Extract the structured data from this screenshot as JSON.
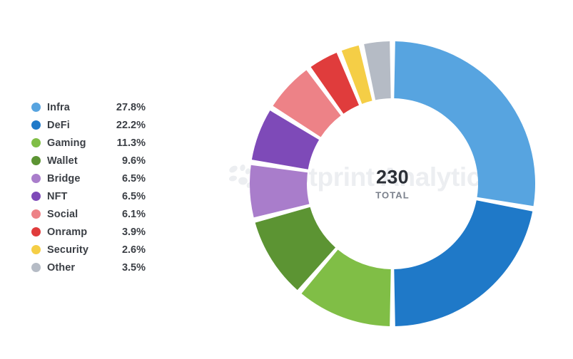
{
  "chart_data": {
    "type": "pie",
    "title": "",
    "subtitle": "",
    "variant": "donut",
    "categories": [
      "Infra",
      "DeFi",
      "Gaming",
      "Wallet",
      "Bridge",
      "NFT",
      "Social",
      "Onramp",
      "Security",
      "Other"
    ],
    "values": [
      27.8,
      22.2,
      11.3,
      9.6,
      6.5,
      6.5,
      6.1,
      3.9,
      2.6,
      3.5
    ],
    "value_labels": [
      "27.8%",
      "22.2%",
      "11.3%",
      "9.6%",
      "6.5%",
      "6.5%",
      "6.1%",
      "3.9%",
      "2.6%",
      "3.5%"
    ],
    "unit": "%",
    "colors": [
      "#57A4E0",
      "#1F79C8",
      "#80BE46",
      "#5C9433",
      "#A97DCB",
      "#7E4AB8",
      "#ED8287",
      "#E03C3C",
      "#F5CE46",
      "#B5BBC5"
    ],
    "total": 230,
    "total_label": "TOTAL",
    "start_angle_deg": 0,
    "direction": "clockwise",
    "inner_radius_ratio": 0.6,
    "legend_position": "left",
    "grid": false
  },
  "legend": {
    "items": [
      {
        "label": "Infra",
        "value": "27.8%",
        "color": "#57A4E0"
      },
      {
        "label": "DeFi",
        "value": "22.2%",
        "color": "#1F79C8"
      },
      {
        "label": "Gaming",
        "value": "11.3%",
        "color": "#80BE46"
      },
      {
        "label": "Wallet",
        "value": "9.6%",
        "color": "#5C9433"
      },
      {
        "label": "Bridge",
        "value": "6.5%",
        "color": "#A97DCB"
      },
      {
        "label": "NFT",
        "value": "6.5%",
        "color": "#7E4AB8"
      },
      {
        "label": "Social",
        "value": "6.1%",
        "color": "#ED8287"
      },
      {
        "label": "Onramp",
        "value": "3.9%",
        "color": "#E03C3C"
      },
      {
        "label": "Security",
        "value": "2.6%",
        "color": "#F5CE46"
      },
      {
        "label": "Other",
        "value": "3.5%",
        "color": "#B5BBC5"
      }
    ]
  },
  "center": {
    "value": "230",
    "label": "TOTAL"
  },
  "watermark": {
    "text": "Footprint Analytics",
    "logo_icon": "footprint-logo-icon",
    "color": "#eceef1"
  }
}
